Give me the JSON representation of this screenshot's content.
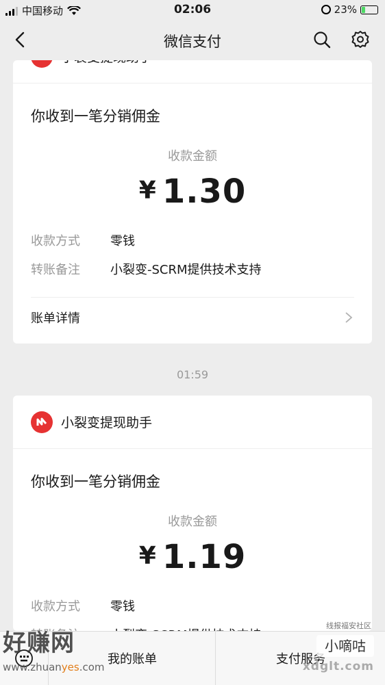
{
  "status_bar": {
    "carrier": "中国移动",
    "time": "02:06",
    "battery": "23%",
    "battery_level": 0.23
  },
  "nav": {
    "title": "微信支付",
    "icons": [
      "back-icon",
      "search-icon",
      "gear-icon"
    ]
  },
  "card1": {
    "brand_name": "小裂变提现助手",
    "title": "你收到一笔分销佣金",
    "amount_label": "收款金额",
    "currency": "¥",
    "amount": "1.30",
    "rows": [
      {
        "key": "收款方式",
        "value": "零钱"
      },
      {
        "key": "转账备注",
        "value": "小裂变-SCRM提供技术支持"
      }
    ],
    "detail_label": "账单详情"
  },
  "timestamp": "01:59",
  "card2": {
    "brand_name": "小裂变提现助手",
    "title": "你收到一笔分销佣金",
    "amount_label": "收款金额",
    "currency": "¥",
    "amount": "1.19",
    "rows": [
      {
        "key": "收款方式",
        "value": "零钱"
      },
      {
        "key": "转账备注",
        "value": "小裂变-SCRM提供技术支持"
      }
    ]
  },
  "tab_bar": {
    "bill_label": "我的账单",
    "service_label": "支付服务"
  },
  "watermarks": {
    "left_text": "好赚网",
    "left_url_a": "www.zhuan",
    "left_url_b": "yes",
    "left_url_c": ".com",
    "right_top": "线报福安社区",
    "right_text": "小嘀咕",
    "right_url": "xdglt.com"
  },
  "colors": {
    "brand_red": "#e63232",
    "background": "#ededed",
    "card": "#ffffff",
    "muted_text": "#999999"
  }
}
